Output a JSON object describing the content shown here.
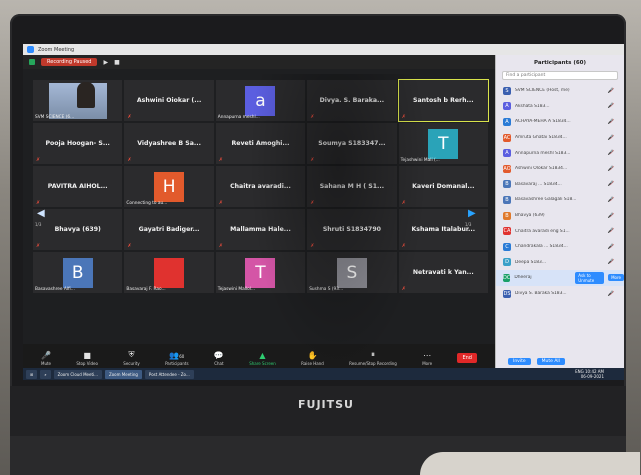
{
  "window": {
    "title": "Zoom Meeting"
  },
  "toolbar": {
    "recording": "Recording Paused"
  },
  "grid": {
    "tiles": [
      {
        "name": "SVM SCIENCE (6...",
        "kind": "video"
      },
      {
        "name": "Ashwini Oiokar (...",
        "kind": "name"
      },
      {
        "name": "a",
        "caption": "Annapurna meshl...",
        "kind": "avatar",
        "color": "#5b5ee0"
      },
      {
        "name": "Divya. S. Baraka...",
        "kind": "name"
      },
      {
        "name": "Santosh b Rerh...",
        "kind": "name",
        "active": true
      },
      {
        "name": "Pooja Hoogan- S...",
        "kind": "name"
      },
      {
        "name": "Vidyashree B Sa...",
        "kind": "name"
      },
      {
        "name": "Reveti Amoghi...",
        "kind": "name"
      },
      {
        "name": "Soumya S183347...",
        "kind": "name"
      },
      {
        "name": "T",
        "caption": "Tejashwini Mali (...",
        "kind": "avatar",
        "color": "#2aa3b8"
      },
      {
        "name": "PAVITRA AIHOL...",
        "kind": "name"
      },
      {
        "name": "H",
        "caption": "Connecting to au...",
        "kind": "avatar",
        "color": "#e25a2c"
      },
      {
        "name": "Chaitra avaradi...",
        "kind": "name"
      },
      {
        "name": "Sahana M H ( S1...",
        "kind": "name"
      },
      {
        "name": "Kaveri Domanal...",
        "kind": "name"
      },
      {
        "name": "Bhavya (639)",
        "kind": "name"
      },
      {
        "name": "Gayatri Badiger...",
        "kind": "name"
      },
      {
        "name": "Mallamma Hale...",
        "kind": "name"
      },
      {
        "name": "Shruti S1834790",
        "kind": "name"
      },
      {
        "name": "Kshama Italabur...",
        "kind": "name"
      },
      {
        "name": "B",
        "caption": "Basavashree Alfi...",
        "kind": "avatar",
        "color": "#4b76b8"
      },
      {
        "name": "",
        "caption": "Basavaraj F. Rao...",
        "kind": "avatar",
        "color": "#e0322f"
      },
      {
        "name": "T",
        "caption": "Tejaswini Mallol...",
        "kind": "avatar",
        "color": "#d455a6"
      },
      {
        "name": "S",
        "caption": "Sushma S (93...",
        "kind": "avatar",
        "color": "#8e8e96"
      },
      {
        "name": "Netravati k Yan...",
        "kind": "name"
      }
    ],
    "page_left": "1/3",
    "page_right": "1/3"
  },
  "bottombar": {
    "mute": "Mute",
    "stop_video": "Stop Video",
    "security": "Security",
    "participants": "Participants",
    "participants_count": "60",
    "chat": "Chat",
    "share_screen": "Share Screen",
    "raise_hand": "Raise Hand",
    "recording": "Resume/Stop Recording",
    "more": "More",
    "end": "End"
  },
  "panel": {
    "title": "Participants (60)",
    "search_placeholder": "Find a participant",
    "participants": [
      {
        "initial": "S",
        "name": "SVM SCIENCE (Host, me)",
        "color": "#3a5fb0"
      },
      {
        "initial": "A",
        "name": "Akshata S183...",
        "color": "#5b5ee0"
      },
      {
        "initial": "A",
        "name": "ACHAYA-MEHA A S1834...",
        "color": "#2a7bd6"
      },
      {
        "initial": "AC",
        "name": "Amruta Ghatai S1834...",
        "color": "#e25a2c"
      },
      {
        "initial": "A",
        "name": "Annapurna meshl S183...",
        "color": "#5b5ee0"
      },
      {
        "initial": "AO",
        "name": "Ashwini Olokar S1834...",
        "color": "#e25a2c"
      },
      {
        "initial": "B",
        "name": "Basavaraj ... S1834...",
        "color": "#4b76b8"
      },
      {
        "initial": "B",
        "name": "Basavashree Galagali S18...",
        "color": "#4b76b8"
      },
      {
        "initial": "B",
        "name": "Bhavya (639)",
        "color": "#e07a2c"
      },
      {
        "initial": "CA",
        "name": "Chaitra avaradi eng S1...",
        "color": "#e0322f"
      },
      {
        "initial": "C",
        "name": "Chandrakala ... S1834...",
        "color": "#2a7bd6"
      },
      {
        "initial": "D",
        "name": "Deepa S183...",
        "color": "#3aa0c8"
      },
      {
        "initial": "DC",
        "name": "Dheeraj",
        "color": "#1aa068"
      },
      {
        "initial": "DS",
        "name": "Divya S. Baraka S183...",
        "color": "#3a5fb0"
      }
    ],
    "ask_unmute": "Ask to Unmute",
    "more": "More",
    "invite": "Invite",
    "mute_all": "Mute All"
  },
  "taskbar": {
    "items": [
      "Zoom Cloud Meeti...",
      "Zoom Meeting",
      "Post Attendee - Zo..."
    ],
    "time": "10:42 AM",
    "date": "06-09-2021",
    "lang": "ENG"
  },
  "device": {
    "brand": "FUJITSU"
  }
}
